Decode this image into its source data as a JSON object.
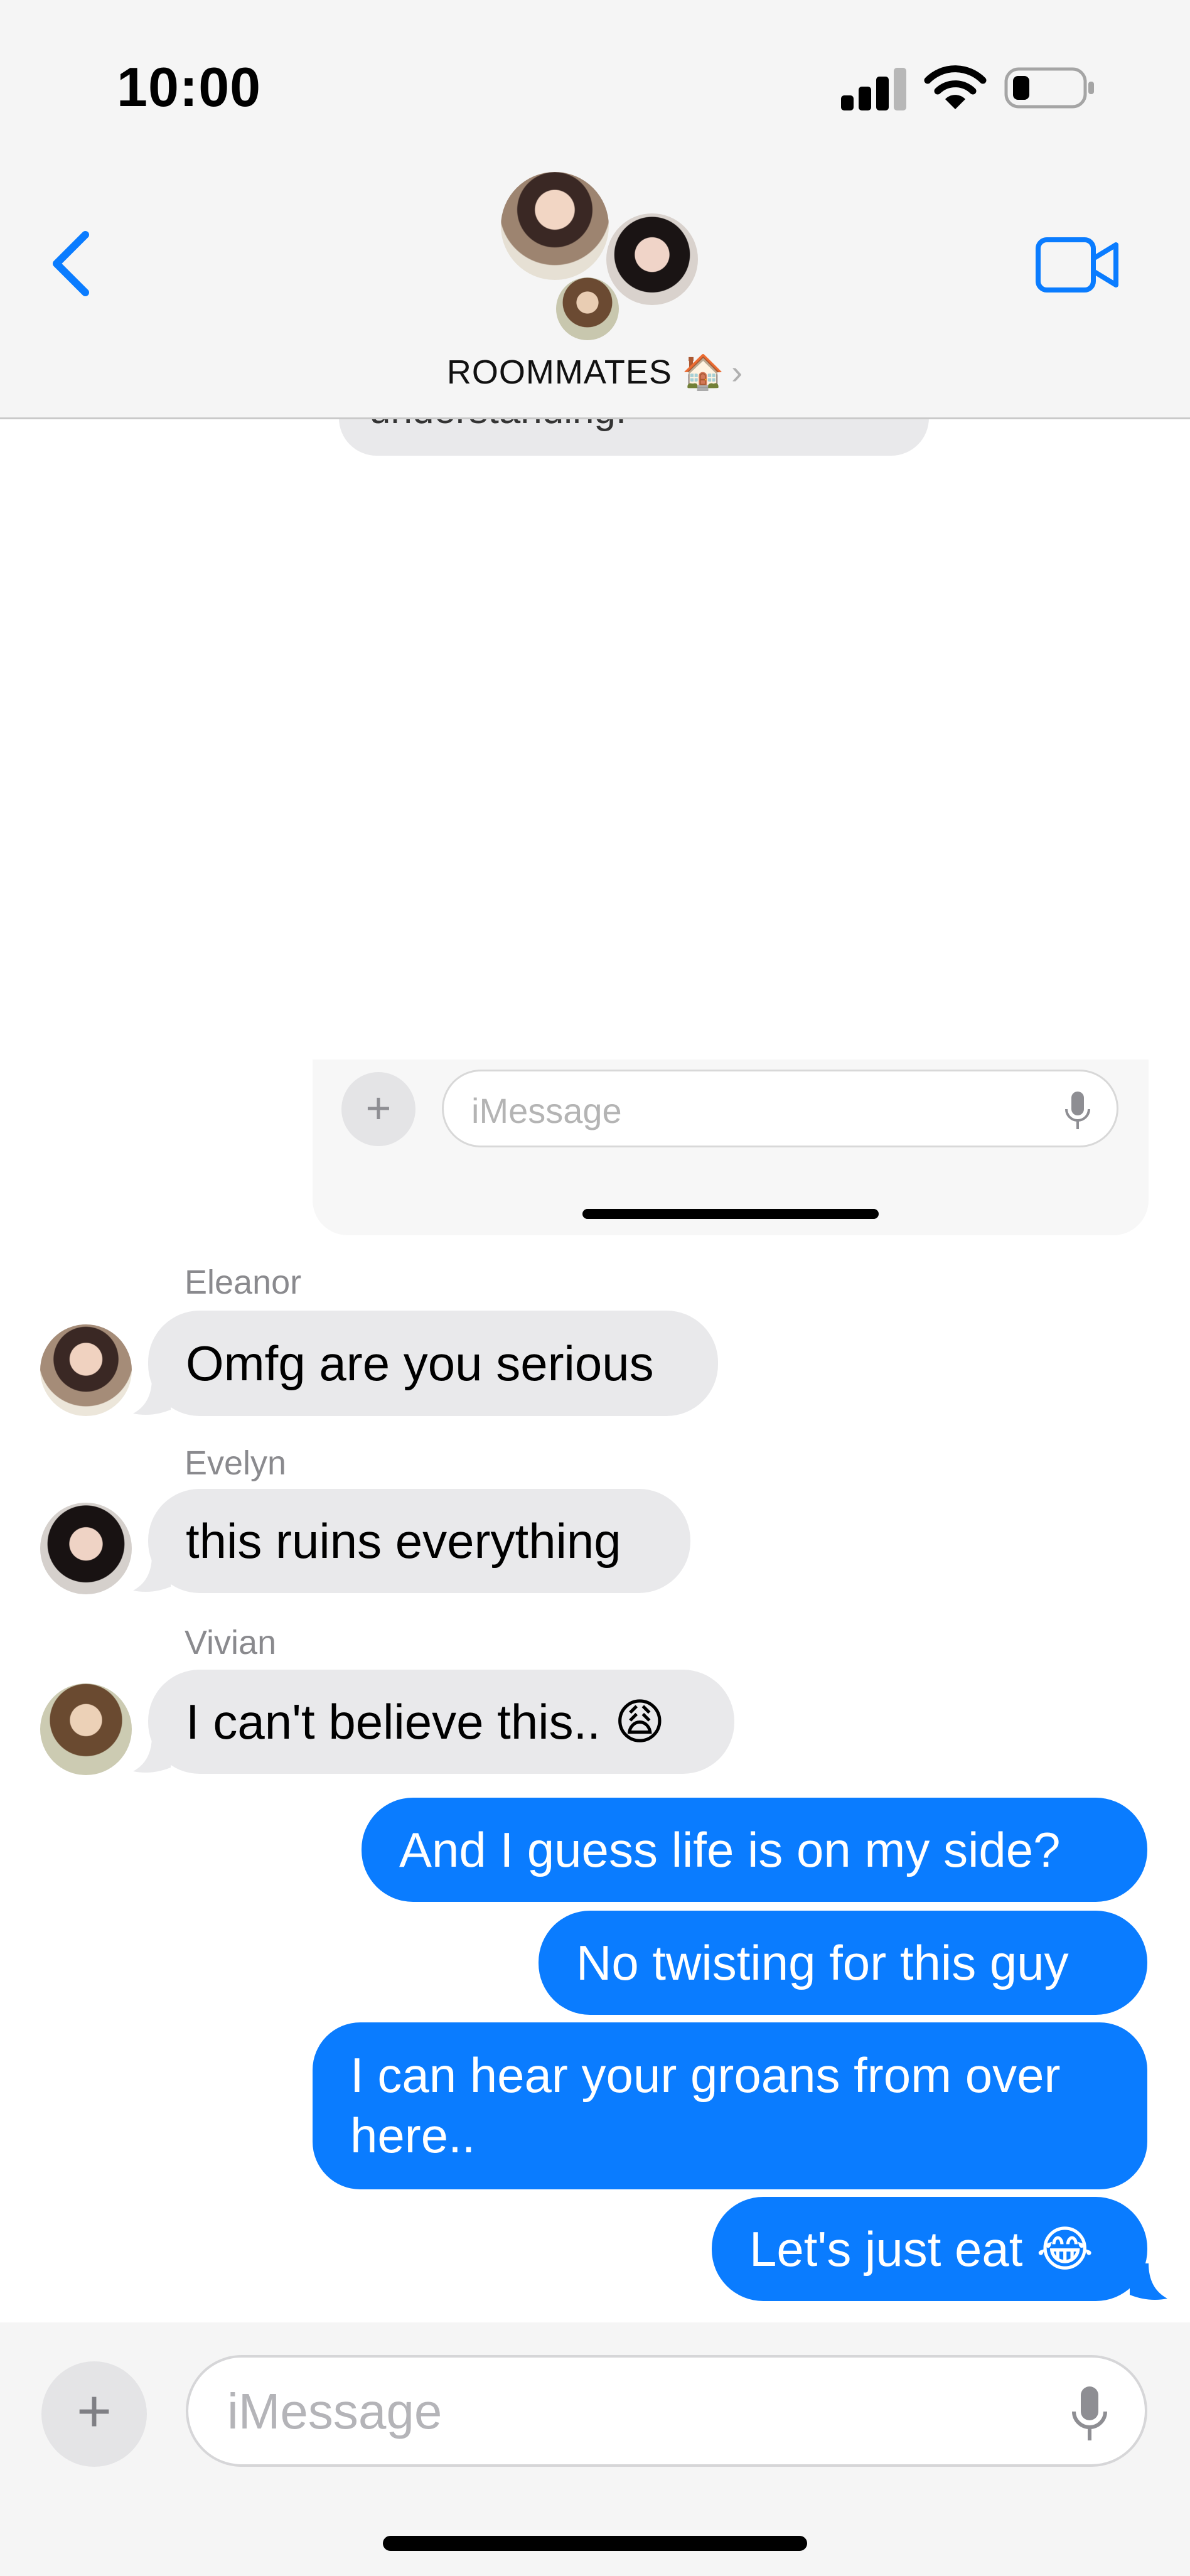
{
  "status_bar": {
    "time": "10:00"
  },
  "header": {
    "group_name": "ROOMMATES 🏠",
    "chevron": "›",
    "back_icon": "chevron-left-icon",
    "video_icon": "video-camera-icon"
  },
  "clipped_message": {
    "text": "understanding."
  },
  "embedded_composer": {
    "plus": "+",
    "placeholder": "iMessage"
  },
  "messages": [
    {
      "sender": "Eleanor",
      "text": "Omfg are you serious"
    },
    {
      "sender": "Evelyn",
      "text": "this ruins everything"
    },
    {
      "sender": "Vivian",
      "text": "I can't believe this.. 😩"
    },
    {
      "sender": "me",
      "text": "And I guess life is on my side?"
    },
    {
      "sender": "me",
      "text": "No twisting for this guy"
    },
    {
      "sender": "me",
      "text": "I can hear your groans from over here.."
    },
    {
      "sender": "me",
      "text": "Let's just eat 😂"
    }
  ],
  "composer": {
    "plus": "+",
    "placeholder": "iMessage"
  },
  "colors": {
    "outgoing": "#0a7cff",
    "incoming": "#e9e9eb",
    "accent": "#0a7cff"
  }
}
